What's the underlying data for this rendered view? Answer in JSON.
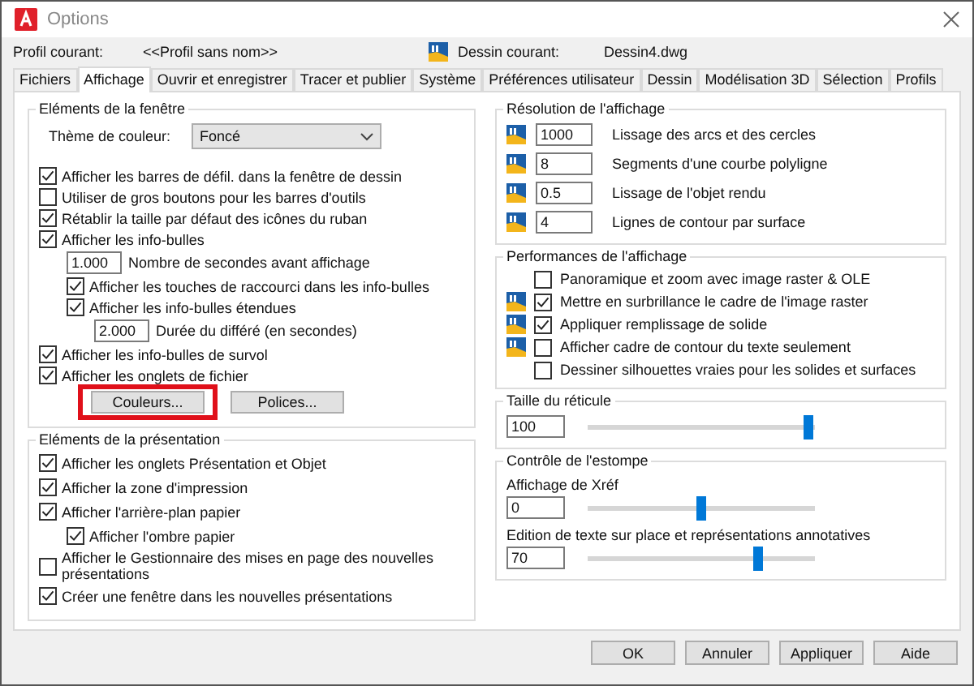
{
  "window": {
    "title": "Options"
  },
  "profile": {
    "label": "Profil courant:",
    "value": "<<Profil sans nom>>"
  },
  "drawing": {
    "label": "Dessin courant:",
    "value": "Dessin4.dwg"
  },
  "tabs": [
    {
      "label": "Fichiers",
      "selected": false
    },
    {
      "label": "Affichage",
      "selected": true
    },
    {
      "label": "Ouvrir et enregistrer",
      "selected": false
    },
    {
      "label": "Tracer et publier",
      "selected": false
    },
    {
      "label": "Système",
      "selected": false
    },
    {
      "label": "Préférences utilisateur",
      "selected": false
    },
    {
      "label": "Dessin",
      "selected": false
    },
    {
      "label": "Modélisation 3D",
      "selected": false
    },
    {
      "label": "Sélection",
      "selected": false
    },
    {
      "label": "Profils",
      "selected": false
    }
  ],
  "window_elements": {
    "title": "Eléments de la fenêtre",
    "theme": {
      "label": "Thème de couleur:",
      "value": "Foncé"
    },
    "items": [
      {
        "kind": "checkbox",
        "label": "Afficher les barres de défil. dans la fenêtre de dessin",
        "checked": true
      },
      {
        "kind": "checkbox",
        "label": "Utiliser de gros boutons pour les barres d'outils",
        "checked": false
      },
      {
        "kind": "checkbox",
        "label": "Rétablir la taille par défaut des icônes du ruban",
        "checked": true
      },
      {
        "kind": "checkbox",
        "label": "Afficher les info-bulles",
        "checked": true,
        "children": [
          {
            "kind": "number",
            "value": "1.000",
            "label": "Nombre de secondes avant affichage"
          },
          {
            "kind": "checkbox",
            "label": "Afficher les touches de raccourci dans les info-bulles",
            "checked": true
          },
          {
            "kind": "checkbox",
            "label": "Afficher les info-bulles étendues",
            "checked": true,
            "children": [
              {
                "kind": "number",
                "value": "2.000",
                "label": "Durée du différé (en secondes)"
              }
            ]
          }
        ]
      },
      {
        "kind": "checkbox",
        "label": "Afficher les info-bulles de survol",
        "checked": true
      },
      {
        "kind": "checkbox",
        "label": "Afficher les onglets de fichier",
        "checked": true
      }
    ],
    "buttons": [
      {
        "label": "Couleurs...",
        "highlighted": true
      },
      {
        "label": "Polices...",
        "highlighted": false
      }
    ]
  },
  "layout_elements": {
    "title": "Eléments de la présentation",
    "items": [
      {
        "kind": "checkbox",
        "label": "Afficher les onglets Présentation et Objet",
        "checked": true
      },
      {
        "kind": "checkbox",
        "label": "Afficher la zone d'impression",
        "checked": true
      },
      {
        "kind": "checkbox",
        "label": "Afficher l'arrière-plan papier",
        "checked": true,
        "children": [
          {
            "kind": "checkbox",
            "label": "Afficher l'ombre papier",
            "checked": true
          }
        ]
      },
      {
        "kind": "checkbox",
        "label": "Afficher le Gestionnaire des mises en page des nouvelles présentations",
        "checked": false
      },
      {
        "kind": "checkbox",
        "label": "Créer une fenêtre dans les nouvelles présentations",
        "checked": true
      }
    ]
  },
  "resolution": {
    "title": "Résolution de l'affichage",
    "items": [
      {
        "value": "1000",
        "label": "Lissage des arcs et des cercles"
      },
      {
        "value": "8",
        "label": "Segments d'une courbe polyligne"
      },
      {
        "value": "0.5",
        "label": "Lissage de l'objet rendu"
      },
      {
        "value": "4",
        "label": "Lignes de contour par surface"
      }
    ]
  },
  "performance": {
    "title": "Performances de l'affichage",
    "items": [
      {
        "label": "Panoramique et zoom avec image raster & OLE",
        "checked": false,
        "drawing_icon": false
      },
      {
        "label": "Mettre en surbrillance le cadre de l'image raster",
        "checked": true,
        "drawing_icon": true
      },
      {
        "label": "Appliquer remplissage de solide",
        "checked": true,
        "drawing_icon": true
      },
      {
        "label": "Afficher cadre de contour du texte seulement",
        "checked": false,
        "drawing_icon": true
      },
      {
        "label": "Dessiner silhouettes vraies pour les solides et surfaces",
        "checked": false,
        "drawing_icon": false
      }
    ]
  },
  "crosshair": {
    "title": "Taille du réticule",
    "value": "100",
    "level": 0.97
  },
  "fade": {
    "title": "Contrôle de l'estompe",
    "sliders": [
      {
        "label": "Affichage de Xréf",
        "value": "0",
        "level": 0.5
      },
      {
        "label": "Edition de texte sur place et représentations annotatives",
        "value": "70",
        "level": 0.75
      }
    ]
  },
  "buttons": [
    "OK",
    "Annuler",
    "Appliquer",
    "Aide"
  ]
}
